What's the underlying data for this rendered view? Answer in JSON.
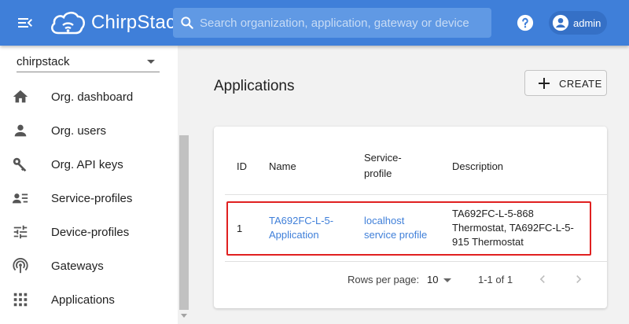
{
  "header": {
    "brand": "ChirpStack",
    "search_placeholder": "Search organization, application, gateway or device",
    "user": "admin",
    "icons": {
      "menu": "menu-open-icon",
      "logo": "cloud-wifi-icon",
      "search": "search-icon",
      "help": "help-circle-icon",
      "user": "account-circle-icon"
    },
    "colors": {
      "appbar": "#3f7fd9",
      "link": "#3f7fd9"
    }
  },
  "sidebar": {
    "organization": "chirpstack",
    "items": [
      {
        "label": "Org. dashboard",
        "icon": "home-icon"
      },
      {
        "label": "Org. users",
        "icon": "person-icon"
      },
      {
        "label": "Org. API keys",
        "icon": "key-icon"
      },
      {
        "label": "Service-profiles",
        "icon": "account-details-icon"
      },
      {
        "label": "Device-profiles",
        "icon": "tune-icon"
      },
      {
        "label": "Gateways",
        "icon": "radio-tower-icon"
      },
      {
        "label": "Applications",
        "icon": "apps-icon"
      }
    ]
  },
  "main": {
    "title": "Applications",
    "create_label": "CREATE",
    "table": {
      "headers": {
        "id": "ID",
        "name": "Name",
        "service_profile_line1": "Service-",
        "service_profile_line2": "profile",
        "description": "Description"
      },
      "rows": [
        {
          "id": "1",
          "name_line1": "TA692FC-L-5-",
          "name_line2": "Application",
          "service_line1": "localhost",
          "service_line2": "service profile",
          "desc_line1": "TA692FC-L-5-868",
          "desc_line2": "Thermostat, TA692FC-L-5-",
          "desc_line3": "915 Thermostat"
        }
      ]
    },
    "pagination": {
      "rows_per_page_label": "Rows per page:",
      "rows_per_page": "10",
      "range": "1-1 of 1"
    }
  }
}
